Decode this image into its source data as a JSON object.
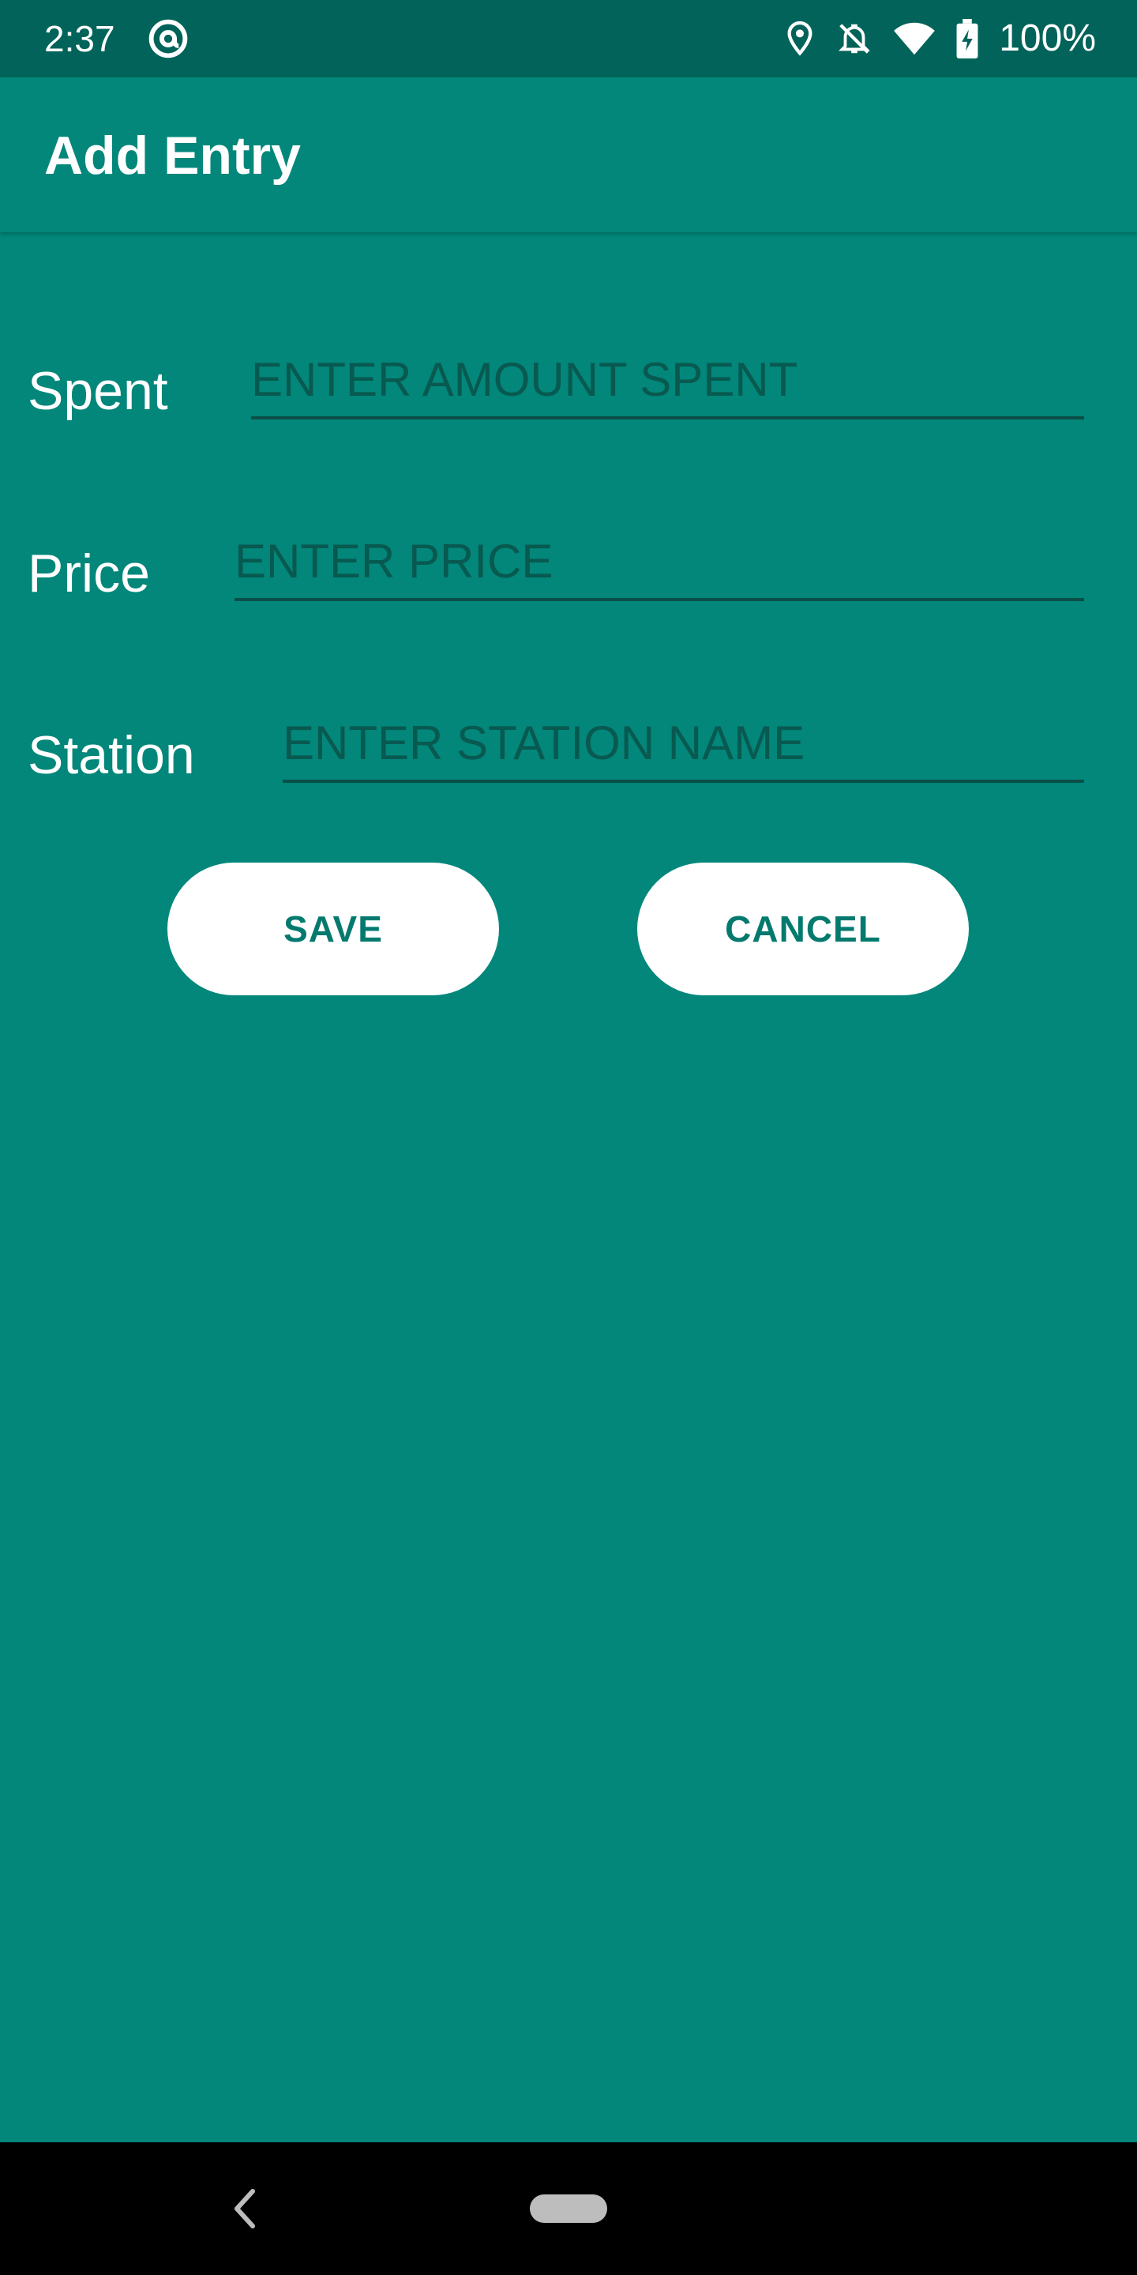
{
  "status_bar": {
    "time": "2:37",
    "battery_percent": "100%",
    "icons": [
      "at-sign-icon",
      "location-pin-icon",
      "notifications-off-icon",
      "wifi-icon",
      "battery-charging-icon"
    ]
  },
  "app_bar": {
    "title": "Add Entry"
  },
  "form": {
    "spent": {
      "label": "Spent",
      "placeholder": "ENTER AMOUNT SPENT",
      "value": ""
    },
    "price": {
      "label": "Price",
      "placeholder": "ENTER PRICE",
      "value": ""
    },
    "station": {
      "label": "Station",
      "placeholder": "ENTER STATION NAME",
      "value": ""
    }
  },
  "buttons": {
    "save": "SAVE",
    "cancel": "CANCEL"
  },
  "nav_bar": {
    "icons": [
      "back-icon",
      "home-pill-icon"
    ]
  },
  "colors": {
    "background": "#02877A",
    "status_bar": "#016359",
    "button_text": "#047A6F",
    "button_bg": "#FFFFFF"
  }
}
